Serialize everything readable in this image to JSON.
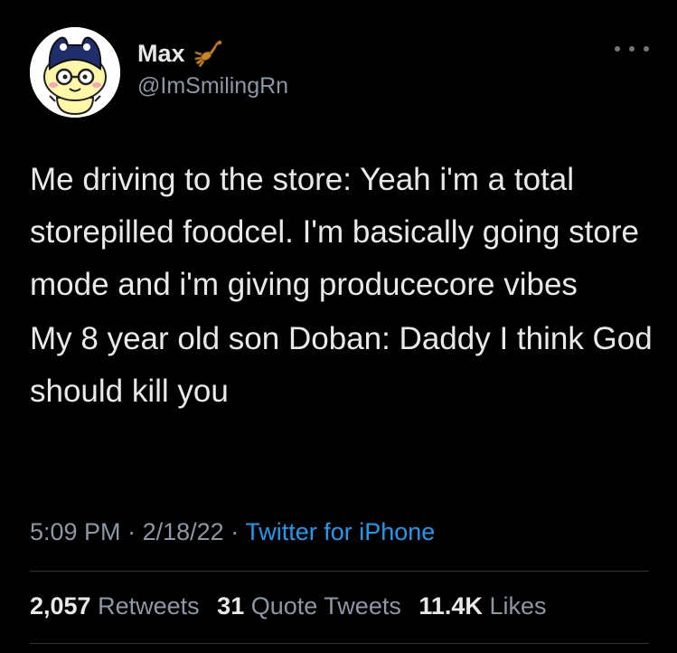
{
  "author": {
    "display_name": "Max",
    "handle": "@ImSmilingRn",
    "badge_icon": "scorpion-icon",
    "avatar_icon": "mametchi-avatar"
  },
  "tweet": {
    "paragraphs": [
      "Me driving to the store: Yeah i'm a total storepilled foodcel. I'm basically going store mode and i'm giving producecore vibes",
      "My 8 year old son Doban: Daddy I think God should kill you"
    ],
    "time": "5:09 PM",
    "separator": "·",
    "date": "2/18/22",
    "source": "Twitter for iPhone"
  },
  "stats": {
    "retweets_count": "2,057",
    "retweets_label": "Retweets",
    "quotes_count": "31",
    "quotes_label": "Quote Tweets",
    "likes_count": "11.4K",
    "likes_label": "Likes"
  },
  "colors": {
    "background": "#000000",
    "text": "#e7e9ea",
    "muted": "#8b98a5",
    "link": "#1d9bf0",
    "divider": "#2f3336"
  }
}
